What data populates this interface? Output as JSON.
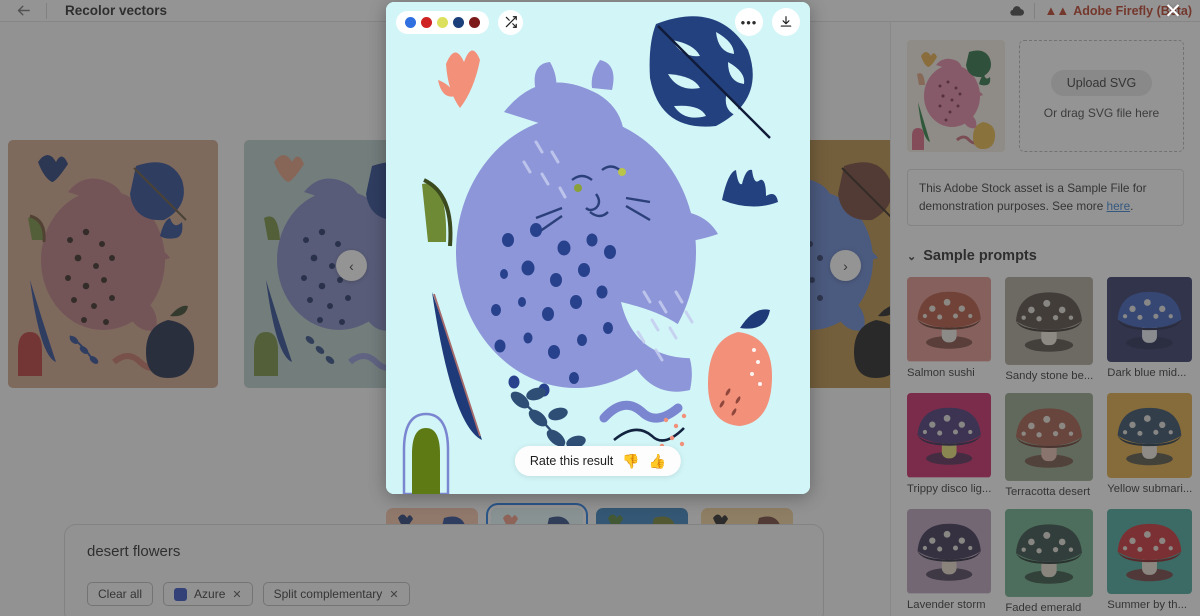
{
  "topbar": {
    "back_icon": "back-arrow-icon",
    "title": "Recolor vectors",
    "cloud_icon": "cloud-icon",
    "brand_mark": "Adobe",
    "brand": "Adobe Firefly (Beta)",
    "brand_color": "#b9321a",
    "close_label": "✕"
  },
  "modal": {
    "swatches": [
      "#2f6fe0",
      "#cf2222",
      "#dde05c",
      "#1b3f7a",
      "#7d1a1a"
    ],
    "shuffle_icon": "shuffle-icon",
    "more_icon": "more-options-icon",
    "more_label": "•••",
    "download_icon": "download-icon",
    "rate_label": "Rate this result",
    "thumb_down_icon": "thumbs-down-icon",
    "thumb_up_icon": "thumbs-up-icon",
    "thumb_down_glyph": "👎",
    "thumb_up_glyph": "👍",
    "background": "#d2f5f7"
  },
  "carousel": {
    "prev_label": "‹",
    "next_label": "›",
    "cards": [
      {
        "name": "terracotta-cat-card",
        "bg": "#cf9f85",
        "cat": "#b6737a",
        "leaf": "#1f3f8f",
        "accent": "#7a5a3a"
      },
      {
        "name": "sage-cat-card",
        "bg": "#b6cdc9",
        "cat": "#7b84c4",
        "leaf": "#1f3f8f",
        "accent": "#e2997a"
      },
      {
        "name": "aqua-cat-card-selected",
        "bg": "#d2f5f7",
        "cat": "#8d96d8",
        "leaf": "#24417f",
        "accent": "#f09479"
      },
      {
        "name": "ochre-cat-card",
        "bg": "#b98b3d",
        "cat": "#5d7fd1",
        "leaf": "#6b3a2b",
        "accent": "#1a1a1a"
      }
    ]
  },
  "prompt": {
    "text": "desert flowers",
    "clear_all": "Clear all",
    "chips": [
      {
        "label": "Azure",
        "swatch": "#2b47c4",
        "remove": "✕"
      },
      {
        "label": "Split complementary",
        "remove": "✕"
      }
    ]
  },
  "filmstrip": [
    {
      "name": "peach-cat-thumb",
      "bg": "#f5c2a4",
      "cat": "#d48a7e",
      "leaf": "#1f3f8f",
      "accent": "#c8473a",
      "selected": false
    },
    {
      "name": "aqua-cat-thumb",
      "bg": "#e4fbfb",
      "cat": "#8d96d8",
      "leaf": "#24417f",
      "accent": "#f09479",
      "selected": true
    },
    {
      "name": "blue-cat-thumb",
      "bg": "#2878b8",
      "cat": "#a9a6e8",
      "leaf": "#6b7b26",
      "accent": "#4d7a2a",
      "selected": false
    },
    {
      "name": "sand-cat-thumb",
      "bg": "#f2cf93",
      "cat": "#6d8ce0",
      "leaf": "#6b3a2b",
      "accent": "#1a1a1a",
      "selected": false
    }
  ],
  "right_panel": {
    "upload_button": "Upload SVG",
    "drop_hint": "Or drag SVG file here",
    "preview_name": "pink-cat-preview",
    "notice_prefix": "This Adobe Stock asset is a Sample File for demonstration purposes. See more ",
    "notice_link": "here",
    "notice_suffix": ".",
    "sample_prompts_title": "Sample prompts",
    "chevron": "⌄",
    "samples": [
      {
        "label": "Salmon sushi",
        "bg": "#e08d85",
        "cap": "#b04a33",
        "capdark": "#5c2a1c",
        "stem": "#f0ece4"
      },
      {
        "label": "Sandy stone be...",
        "bg": "#a8a394",
        "cap": "#4a3f35",
        "capdark": "#2e2720",
        "stem": "#efe8dc"
      },
      {
        "label": "Dark blue mid...",
        "bg": "#252b5c",
        "cap": "#2f54b8",
        "capdark": "#141a40",
        "stem": "#e8eaf4"
      },
      {
        "label": "Trippy disco lig...",
        "bg": "#c9195e",
        "cap": "#3c2b6e",
        "capdark": "#241a45",
        "stem": "#e7e06a"
      },
      {
        "label": "Terracotta desert",
        "bg": "#8fa184",
        "cap": "#9e5240",
        "capdark": "#5e2e22",
        "stem": "#e7b9ab"
      },
      {
        "label": "Yellow submari...",
        "bg": "#e0a73a",
        "cap": "#27415c",
        "capdark": "#17283a",
        "stem": "#f1ecdf"
      },
      {
        "label": "Lavender storm",
        "bg": "#b79cb8",
        "cap": "#2e2448",
        "capdark": "#1a142c",
        "stem": "#e6dac8"
      },
      {
        "label": "Faded emerald",
        "bg": "#63ab83",
        "cap": "#27413a",
        "capdark": "#162723",
        "stem": "#e7ddcb"
      },
      {
        "label": "Summer by th...",
        "bg": "#3da396",
        "cap": "#c8232a",
        "capdark": "#7a1318",
        "stem": "#ece2d2"
      }
    ]
  }
}
